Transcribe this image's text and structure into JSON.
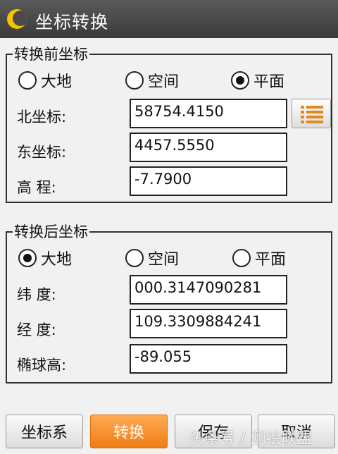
{
  "title": "坐标转换",
  "before": {
    "legend": "转换前坐标",
    "modes": [
      "大地",
      "空间",
      "平面"
    ],
    "selected": 2,
    "fields": [
      {
        "label": "北坐标:",
        "value": "58754.4150"
      },
      {
        "label": "东坐标:",
        "value": "4457.5550"
      },
      {
        "label": "高 程:",
        "value": "-7.7900"
      }
    ]
  },
  "after": {
    "legend": "转换后坐标",
    "modes": [
      "大地",
      "空间",
      "平面"
    ],
    "selected": 0,
    "fields": [
      {
        "label": "纬 度:",
        "value": "000.3147090281"
      },
      {
        "label": "经 度:",
        "value": "109.3309884241"
      },
      {
        "label": "椭球高:",
        "value": "-89.055"
      }
    ]
  },
  "buttons": {
    "coord_sys": "坐标系",
    "convert": "转换",
    "save": "保存",
    "cancel": "取消"
  },
  "watermark": "头条号 / 测绘联盟",
  "colors": {
    "accent": "#f28c28",
    "titlebar": "#454545",
    "logo": "#f5c400"
  }
}
